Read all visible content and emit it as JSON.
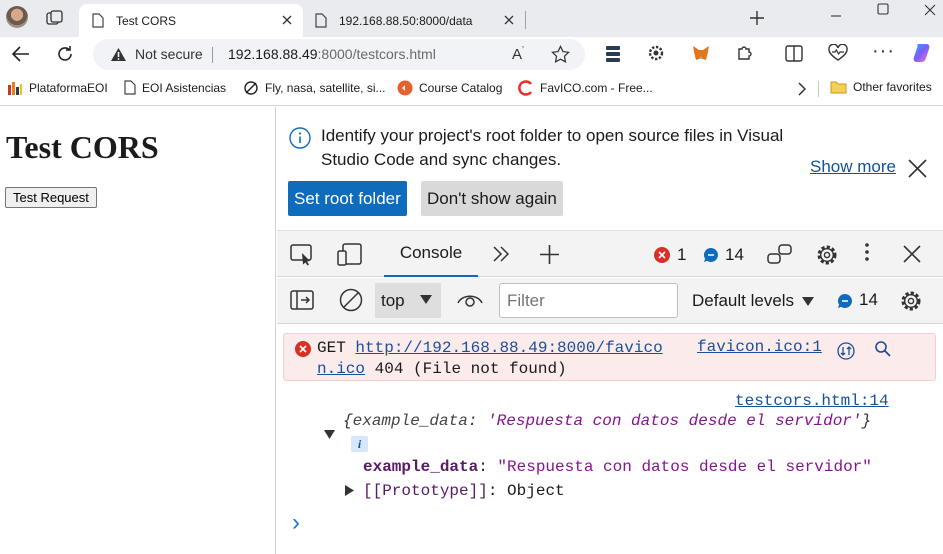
{
  "tabs": [
    {
      "title": "Test CORS",
      "active": true
    },
    {
      "title": "192.168.88.50:8000/data",
      "active": false
    }
  ],
  "address": {
    "security_label": "Not secure",
    "url_host": "192.168.88.49",
    "url_rest": ":8000/testcors.html"
  },
  "bookmarks": [
    {
      "label": "PlataformaEOI",
      "icon": "bars-chart-icon"
    },
    {
      "label": "EOI Asistencias",
      "icon": "page-icon"
    },
    {
      "label": "Fly, nasa, satellite, si...",
      "icon": "plane-icon"
    },
    {
      "label": "Course Catalog",
      "icon": "course-icon"
    },
    {
      "label": "FavICO.com - Free...",
      "icon": "favico-icon"
    }
  ],
  "other_favorites": "Other favorites",
  "page": {
    "heading": "Test CORS",
    "button": "Test Request"
  },
  "devtools": {
    "info_message": "Identify your project's root folder to open source files in Visual Studio Code and sync changes.",
    "set_root_label": "Set root folder",
    "dont_show_label": "Don't show again",
    "show_more_label": "Show more",
    "console_tab": "Console",
    "error_count": "1",
    "message_count": "14",
    "context": "top",
    "filter_placeholder": "Filter",
    "levels_label": "Default levels",
    "levels_count": "14",
    "error_entry": {
      "method": "GET",
      "url_line1": "http://192.168.88.49:8000/favico",
      "url_line2": "n.ico",
      "status": "404 (File not found)",
      "source": "favicon.ico:1"
    },
    "log_entry": {
      "source": "testcors.html:14",
      "summary_open": "{",
      "summary_key": "example_data",
      "summary_sep": ": ",
      "summary_value": "'Respuesta con datos desde el servidor'",
      "summary_close": "}",
      "info_badge": "i",
      "prop_key": "example_data",
      "prop_sep": ": ",
      "prop_value": "\"Respuesta con datos desde el servidor\"",
      "proto_key": "[[Prototype]]",
      "proto_sep": ": ",
      "proto_value": "Object"
    },
    "prompt": "›"
  },
  "colors": {
    "accent": "#0f6cbd",
    "error": "#d93025",
    "error_bg": "#fcebeb",
    "string": "#881391",
    "key": "#5a1a66"
  }
}
